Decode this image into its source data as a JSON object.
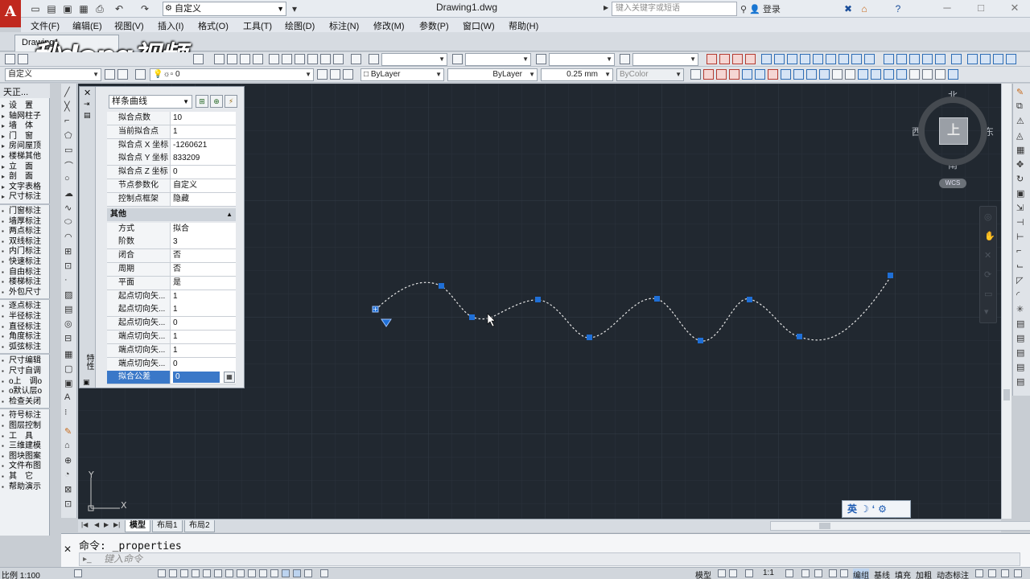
{
  "window": {
    "doc_title": "Drawing1.dwg",
    "workspace": "自定义",
    "search_placeholder": "键入关键字或短语",
    "login_label": "登录"
  },
  "menu": [
    "文件(F)",
    "编辑(E)",
    "视图(V)",
    "插入(I)",
    "格式(O)",
    "工具(T)",
    "绘图(D)",
    "标注(N)",
    "修改(M)",
    "参数(P)",
    "窗口(W)",
    "帮助(H)"
  ],
  "file_tab": "Drawing1",
  "watermark": "秒dong视频",
  "toolbar2": {
    "workspace_combo": "自定义",
    "layer_combo": "0",
    "color_combo": "ByLayer",
    "linetype_combo": "ByLayer",
    "lineweight_combo": "0.25 mm",
    "plotstyle_combo": "ByColor"
  },
  "tz_panel": {
    "title": "天正...",
    "groups": [
      [
        "设　置",
        "轴网柱子",
        "墙　体",
        "门　窗",
        "房间屋顶",
        "楼梯其他",
        "立　面",
        "剖　面",
        "文字表格",
        "尺寸标注"
      ],
      [
        "门窗标注",
        "墙厚标注",
        "两点标注",
        "双线标注",
        "内门标注",
        "快速标注",
        "自由标注",
        "楼梯标注",
        "外包尺寸"
      ],
      [
        "逐点标注",
        "半径标注",
        "直径标注",
        "角度标注",
        "弧弦标注"
      ],
      [
        "尺寸编辑",
        "尺寸自调",
        "o上　调o",
        "o默认层o",
        "检查关闭"
      ],
      [
        "符号标注",
        "图层控制",
        "工　具",
        "三维建模",
        "图块图案",
        "文件布图",
        "其　它",
        "帮助演示"
      ]
    ]
  },
  "properties": {
    "object_type": "样条曲线",
    "side_label": "特性",
    "fit_rows": [
      {
        "name": "拟合点数",
        "value": "10"
      },
      {
        "name": "当前拟合点",
        "value": "1"
      },
      {
        "name": "拟合点 X 坐标",
        "value": "-1260621"
      },
      {
        "name": "拟合点 Y 坐标",
        "value": "833209"
      },
      {
        "name": "拟合点 Z 坐标",
        "value": "0"
      },
      {
        "name": "节点参数化",
        "value": "自定义"
      },
      {
        "name": "控制点框架",
        "value": "隐藏"
      }
    ],
    "other_section": "其他",
    "other_rows": [
      {
        "name": "方式",
        "value": "拟合"
      },
      {
        "name": "阶数",
        "value": "3"
      },
      {
        "name": "闭合",
        "value": "否"
      },
      {
        "name": "周期",
        "value": "否"
      },
      {
        "name": "平面",
        "value": "是"
      },
      {
        "name": "起点切向矢...",
        "value": "1"
      },
      {
        "name": "起点切向矢...",
        "value": "1"
      },
      {
        "name": "起点切向矢...",
        "value": "0"
      },
      {
        "name": "端点切向矢...",
        "value": "1"
      },
      {
        "name": "端点切向矢...",
        "value": "1"
      },
      {
        "name": "端点切向矢...",
        "value": "0"
      }
    ],
    "selected_row": {
      "name": "拟合公差",
      "value": "0"
    }
  },
  "viewcube": {
    "north": "北",
    "south": "南",
    "east": "东",
    "west": "西",
    "face": "上",
    "wcs": "WCS"
  },
  "ucs": {
    "x": "X",
    "y": "Y"
  },
  "layout_tabs": [
    "模型",
    "布局1",
    "布局2"
  ],
  "ime": "英",
  "command": {
    "history": "命令: _properties",
    "placeholder": "键入命令"
  },
  "status": {
    "scale": "比例 1:100",
    "model": "模型",
    "anno_scale": "1:1",
    "items": [
      "编组",
      "基线",
      "填充",
      "加粗",
      "动态标注"
    ]
  },
  "colors": {
    "canvas_bg": "#212830",
    "spline": "#e6e6e6",
    "grip": "#1f6fd6",
    "accent_red": "#c0281e"
  }
}
